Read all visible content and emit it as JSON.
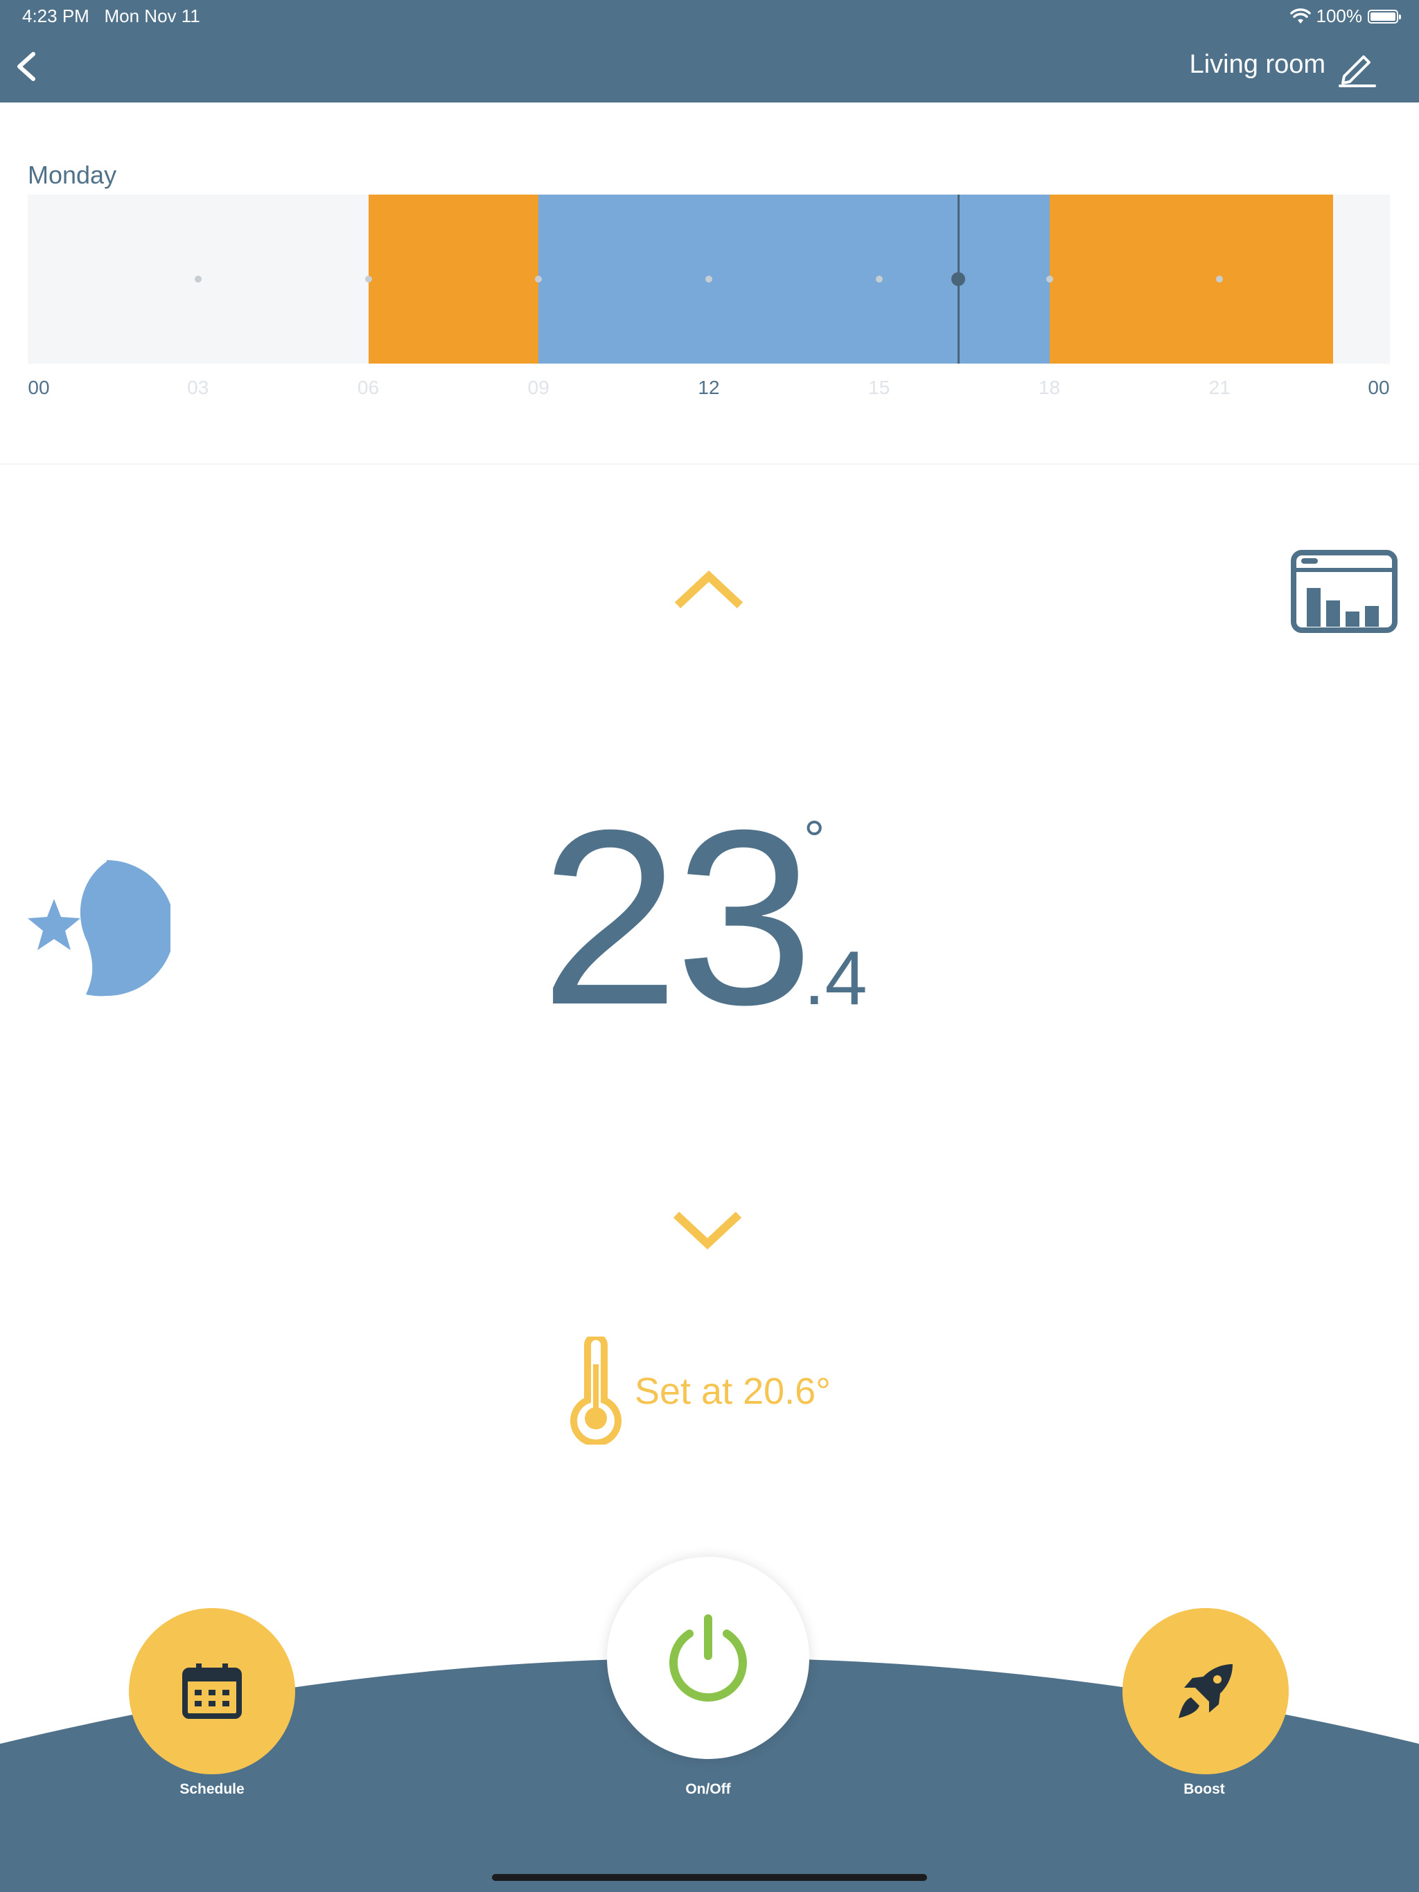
{
  "status_bar": {
    "time": "4:23 PM",
    "date": "Mon Nov 11",
    "battery": "100%"
  },
  "header": {
    "title": "Living room"
  },
  "schedule": {
    "day": "Monday",
    "ticks": [
      "00",
      "03",
      "06",
      "09",
      "12",
      "15",
      "18",
      "21",
      "00"
    ],
    "segments": [
      {
        "start": 0,
        "end": 6,
        "mode": "off"
      },
      {
        "start": 6,
        "end": 9,
        "mode": "comfort"
      },
      {
        "start": 9,
        "end": 18,
        "mode": "eco"
      },
      {
        "start": 18,
        "end": 23,
        "mode": "comfort"
      },
      {
        "start": 23,
        "end": 24,
        "mode": "off"
      }
    ],
    "current_hour": 16.4,
    "colors": {
      "off": "#f5f6f8",
      "comfort": "#f29e2a",
      "eco": "#78a9d8"
    }
  },
  "temperature": {
    "integer": "23",
    "degree": "°",
    "decimal": ".4"
  },
  "setpoint": {
    "text": "Set at 20.6°"
  },
  "colors": {
    "header": "#4f7189",
    "accent": "#f5c451",
    "power": "#8bc34a",
    "moon": "#78a9d8",
    "text": "#4f7189"
  },
  "icons": {
    "back": "chevron-left-icon",
    "edit": "pencil-icon",
    "stats": "statistics-chart-icon",
    "mode": "moon-star-icon",
    "thermometer": "thermometer-icon",
    "schedule": "calendar-icon",
    "power": "power-icon",
    "boost": "rocket-icon"
  },
  "bottom_bar": {
    "schedule_label": "Schedule",
    "power_label": "On/Off",
    "boost_label": "Boost"
  }
}
